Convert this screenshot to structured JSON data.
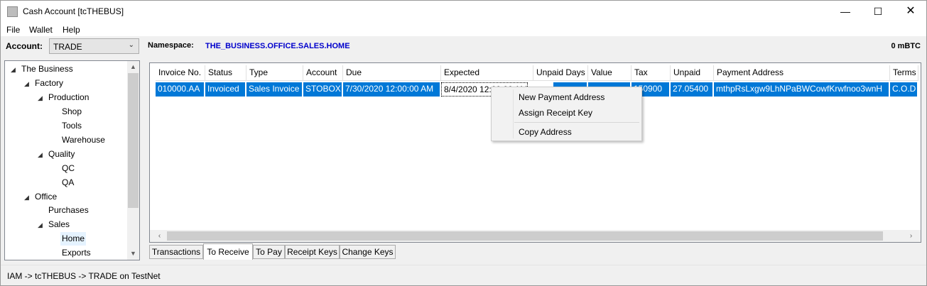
{
  "window": {
    "title": "Cash Account [tcTHEBUS]",
    "min_glyph": "—",
    "max_glyph": "☐",
    "close_glyph": "✕"
  },
  "menu": [
    "File",
    "Wallet",
    "Help"
  ],
  "account": {
    "label": "Account:",
    "selected": "TRADE",
    "arrow": "⌄"
  },
  "namespace": {
    "label": "Namespace:",
    "value": "THE_BUSINESS.OFFICE.SALES.HOME"
  },
  "balance": "0 mBTC",
  "tree": {
    "items": [
      {
        "label": "The Business",
        "expanded": true
      },
      {
        "label": "Factory",
        "expanded": true
      },
      {
        "label": "Production",
        "expanded": true
      },
      {
        "label": "Shop"
      },
      {
        "label": "Tools"
      },
      {
        "label": "Warehouse"
      },
      {
        "label": "Quality",
        "expanded": true
      },
      {
        "label": "QC"
      },
      {
        "label": "QA"
      },
      {
        "label": "Office",
        "expanded": true
      },
      {
        "label": "Purchases"
      },
      {
        "label": "Sales",
        "expanded": true
      },
      {
        "label": "Home",
        "selected": true
      },
      {
        "label": "Exports"
      }
    ],
    "expand_glyph": "◢"
  },
  "grid": {
    "columns": [
      "Invoice No.",
      "Status",
      "Type",
      "Account",
      "Due",
      "Expected",
      "Unpaid Days",
      "Value",
      "Tax",
      "Unpaid",
      "Payment Address",
      "Terms"
    ],
    "row": [
      "010000.AA",
      "Invoiced",
      "Sales Invoice",
      "STOBOX",
      "7/30/2020 12:00:00 AM",
      "8/4/2020 12:00:00 AM",
      "",
      "",
      "150900",
      "27.05400",
      "mthpRsLxgw9LhNPaBWCowfKrwfnoo3wnH",
      "C.O.D"
    ]
  },
  "context_menu": {
    "items": [
      "New Payment Address",
      "Assign Receipt Key",
      "Copy Address"
    ]
  },
  "tabs": [
    {
      "label": "Transactions"
    },
    {
      "label": "To Receive",
      "active": true
    },
    {
      "label": "To Pay"
    },
    {
      "label": "Receipt Keys"
    },
    {
      "label": "Change Keys"
    }
  ],
  "status": "IAM -> tcTHEBUS -> TRADE on TestNet",
  "colors": {
    "selection": "#0078d7",
    "namespace": "#0000cc"
  }
}
